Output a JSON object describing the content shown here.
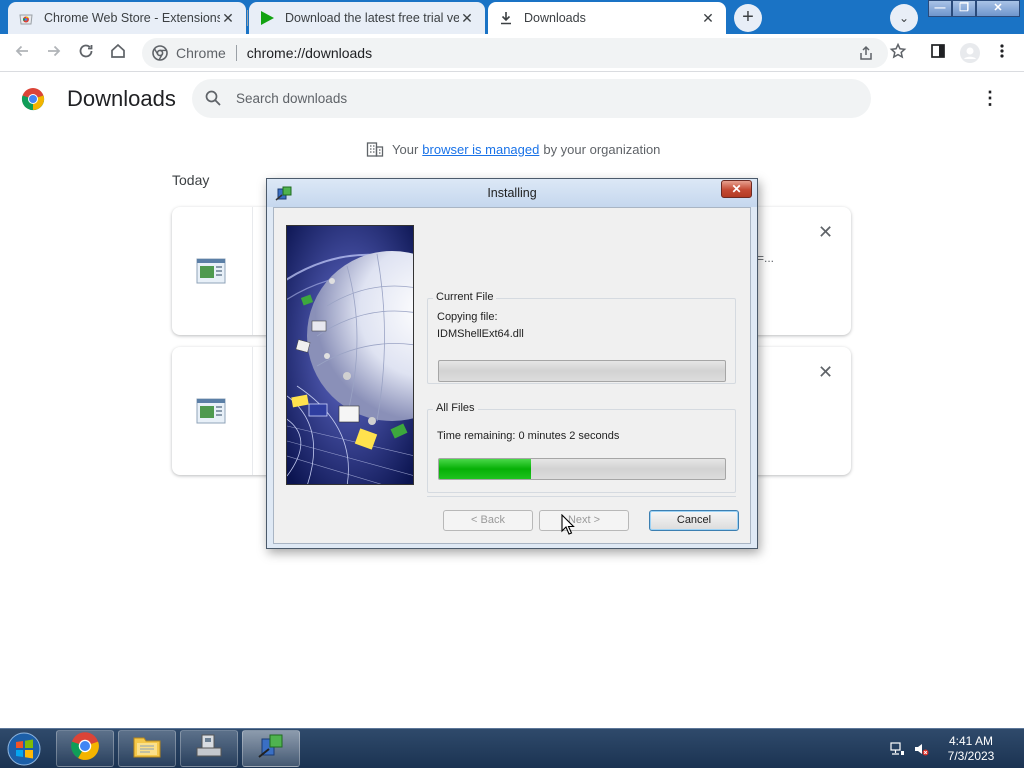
{
  "browser": {
    "tabs": [
      {
        "title": "Chrome Web Store - Extensions",
        "close": "✕",
        "icon": "chrome-web-store-icon"
      },
      {
        "title": "Download the latest free trial ver",
        "close": "✕",
        "icon": "green-play-icon"
      },
      {
        "title": "Downloads",
        "close": "✕",
        "icon": "download-arrow-icon",
        "active": true
      }
    ],
    "new_tab": "+",
    "tab_search": "⌄",
    "window_controls": {
      "minimize": "—",
      "maximize": "❐",
      "close": "✕"
    },
    "omnibox": {
      "site_label": "Chrome",
      "url": "chrome://downloads"
    }
  },
  "downloads_page": {
    "title": "Downloads",
    "search_placeholder": "Search downloads",
    "more_menu": "⋮",
    "managed": {
      "prefix": "Your",
      "link": "browser is managed",
      "suffix": "by your organization"
    },
    "section_label": "Today",
    "items": [
      {
        "remove": "✕",
        "truncated_text": "=..."
      },
      {
        "remove": "✕"
      }
    ]
  },
  "installer": {
    "title": "Installing",
    "close": "✕",
    "current_file": {
      "label": "Current File",
      "line1": "Copying file:",
      "line2": "IDMShellExt64.dll",
      "progress": 0.0
    },
    "all_files": {
      "label": "All Files",
      "time_remaining": "Time remaining: 0 minutes 2 seconds",
      "progress": 0.32
    },
    "buttons": {
      "back": "< Back",
      "next": "Next >",
      "cancel": "Cancel"
    }
  },
  "taskbar": {
    "time": "4:41 AM",
    "date": "7/3/2023",
    "buttons": [
      "chrome-icon",
      "file-explorer-icon",
      "setup-program-icon",
      "installer-icon"
    ]
  },
  "colors": {
    "chrome_blue": "#1a73c5",
    "progress_green": "#06b006",
    "link": "#1a73e8"
  }
}
